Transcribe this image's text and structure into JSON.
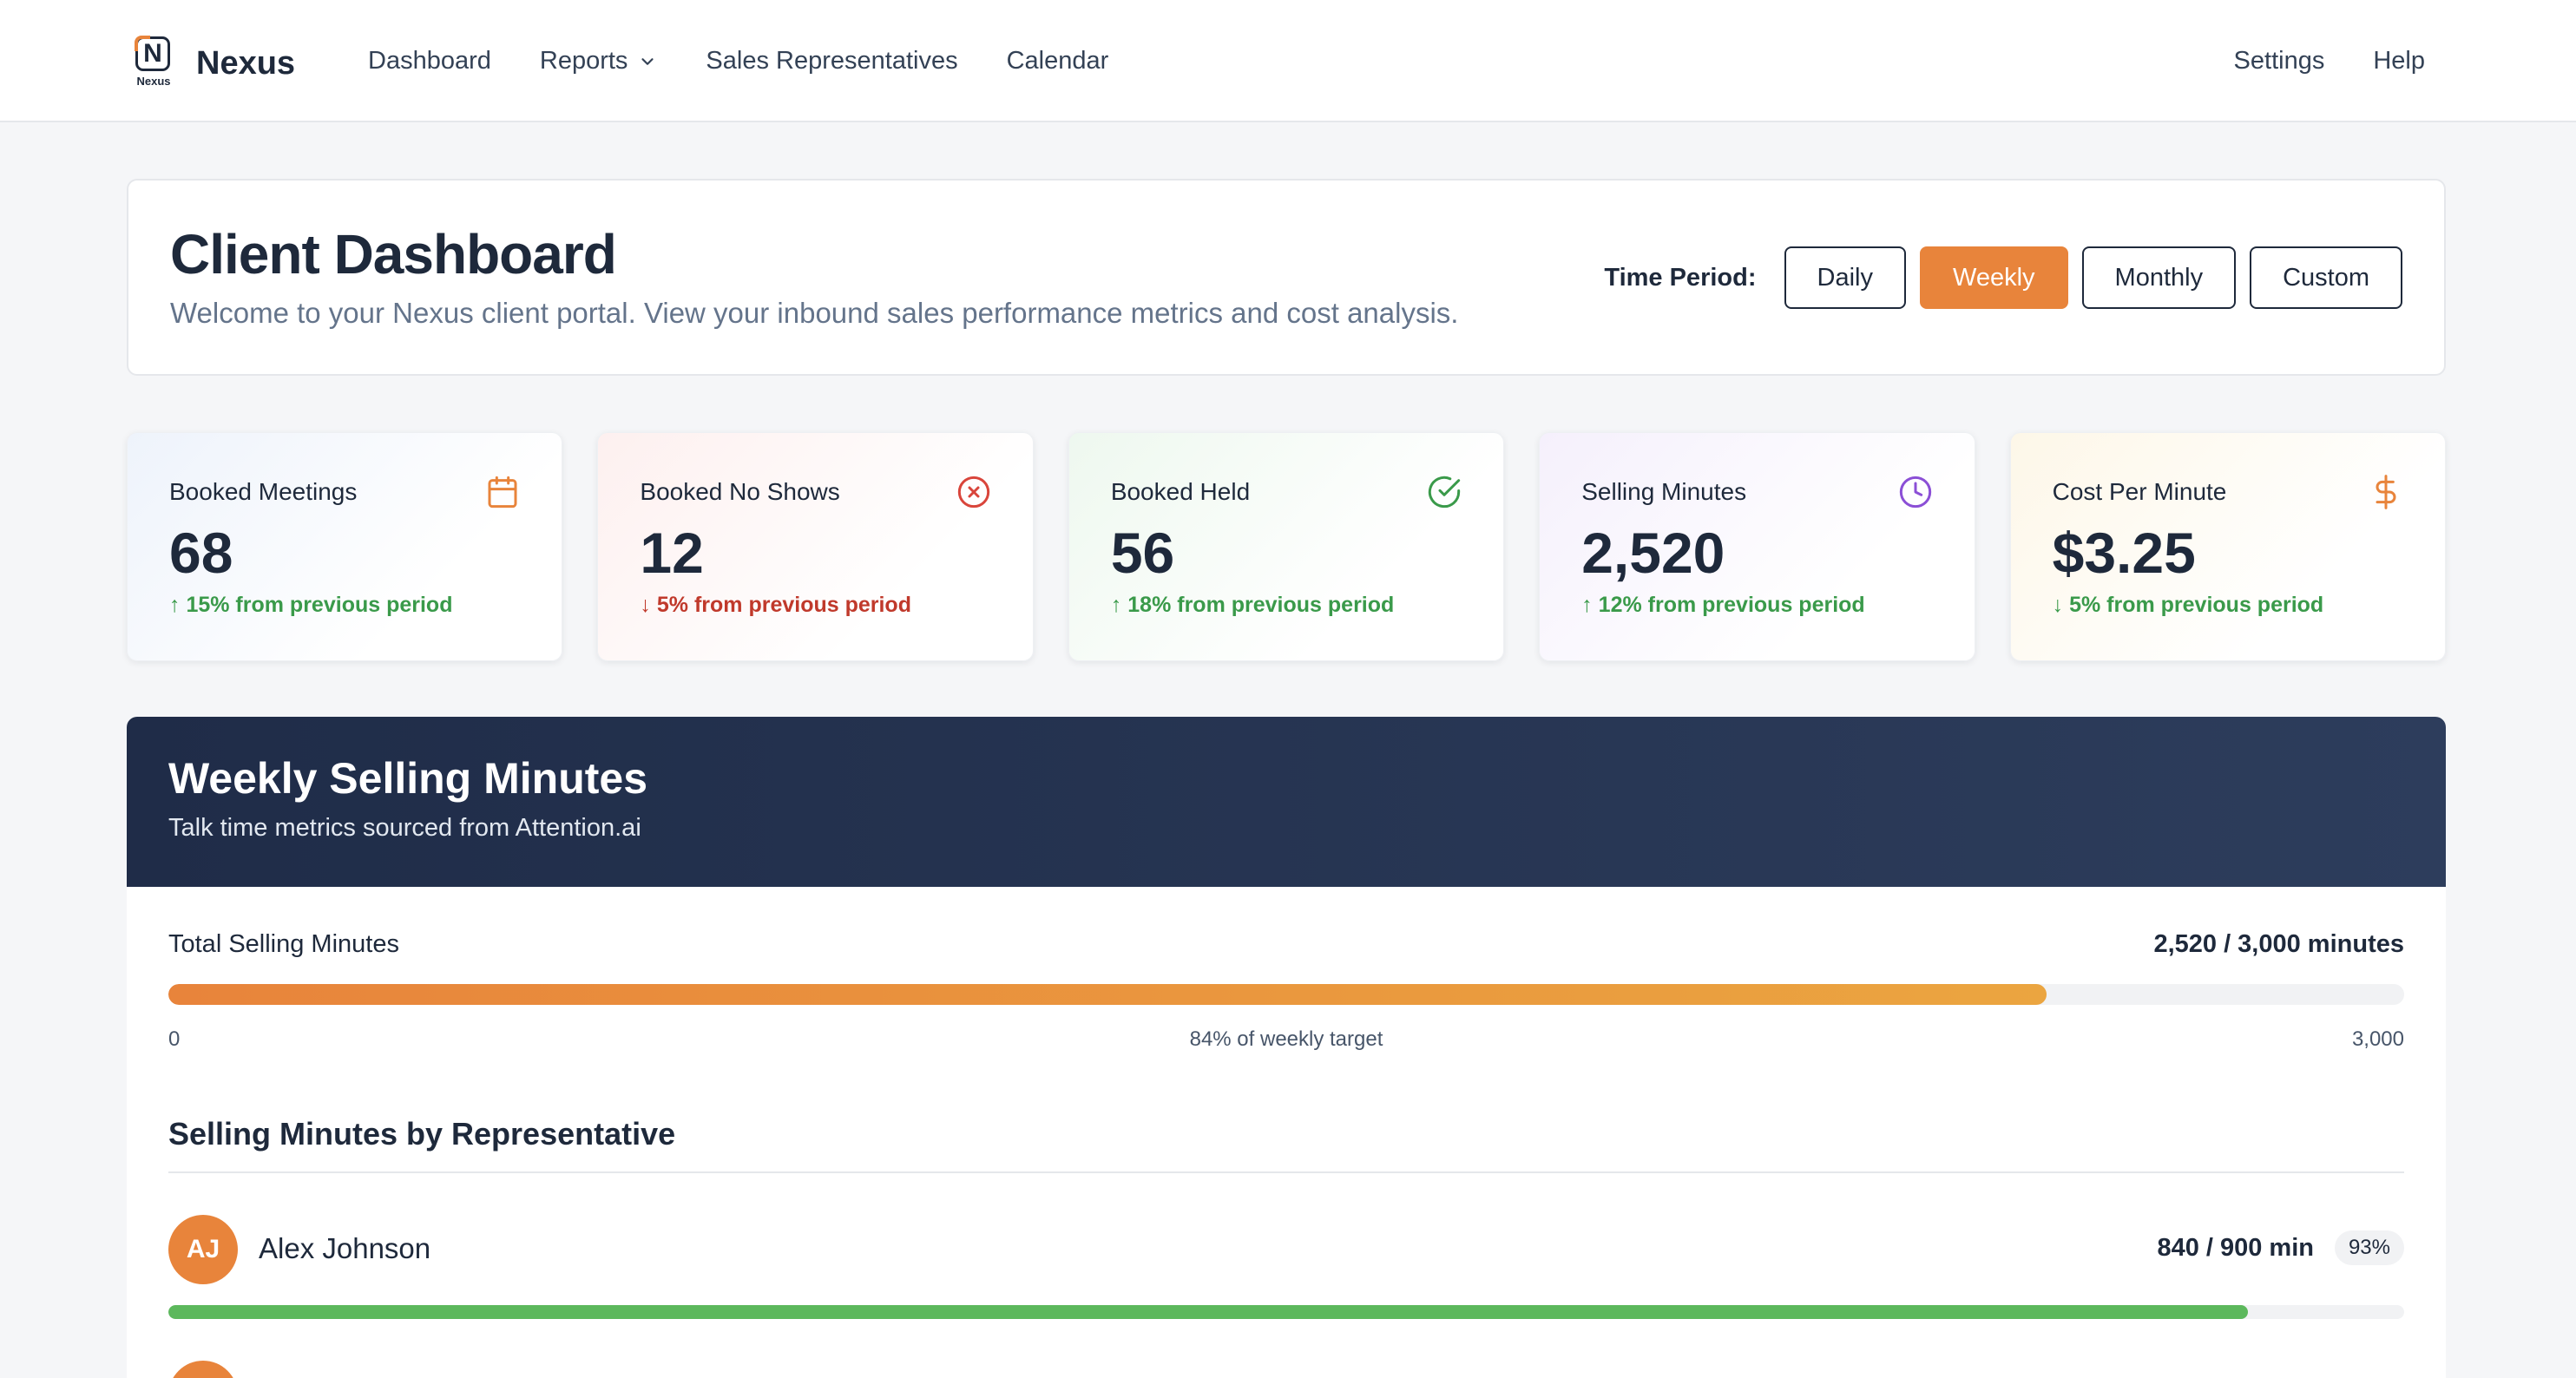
{
  "nav": {
    "brand": "Nexus",
    "logo_letter": "N",
    "logo_caption": "Nexus",
    "links": [
      "Dashboard",
      "Reports",
      "Sales Representatives",
      "Calendar"
    ],
    "right_links": [
      "Settings",
      "Help"
    ]
  },
  "header": {
    "title": "Client Dashboard",
    "subtitle": "Welcome to your Nexus client portal. View your inbound sales performance metrics and cost analysis.",
    "period_label": "Time Period:",
    "periods": [
      "Daily",
      "Weekly",
      "Monthly",
      "Custom"
    ],
    "active_period": "Weekly"
  },
  "stats": [
    {
      "label": "Booked Meetings",
      "value": "68",
      "change": "15% from previous period",
      "direction": "up",
      "icon": "calendar-icon",
      "color": "#e8843b"
    },
    {
      "label": "Booked No Shows",
      "value": "12",
      "change": "5% from previous period",
      "direction": "down",
      "icon": "x-circle-icon",
      "color": "#d9453b"
    },
    {
      "label": "Booked Held",
      "value": "56",
      "change": "18% from previous period",
      "direction": "up",
      "icon": "check-circle-icon",
      "color": "#3a9a4a"
    },
    {
      "label": "Selling Minutes",
      "value": "2,520",
      "change": "12% from previous period",
      "direction": "up",
      "icon": "clock-icon",
      "color": "#8b4fd6"
    },
    {
      "label": "Cost Per Minute",
      "value": "$3.25",
      "change": "5% from previous period",
      "direction": "down-good",
      "icon": "dollar-icon",
      "color": "#e8843b"
    }
  ],
  "minutes": {
    "title": "Weekly Selling Minutes",
    "subtitle": "Talk time metrics sourced from Attention.ai",
    "total_label": "Total Selling Minutes",
    "total_value": "2,520 / 3,000 minutes",
    "progress": 0.84,
    "tick_min": "0",
    "tick_mid": "84% of weekly target",
    "tick_max": "3,000"
  },
  "reps": {
    "title": "Selling Minutes by Representative",
    "items": [
      {
        "initials": "AJ",
        "name": "Alex Johnson",
        "minutes": "840 / 900 min",
        "percent": "93%",
        "progress": 0.93
      }
    ]
  },
  "colors": {
    "accent": "#e8843b",
    "navy": "#1f2c48",
    "success": "#3a9a4a",
    "danger": "#c0392b"
  }
}
